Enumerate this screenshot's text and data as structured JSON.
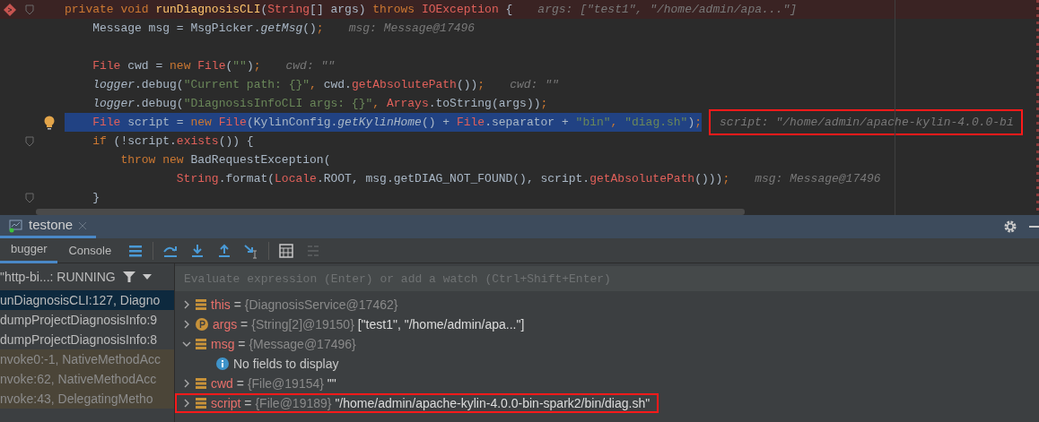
{
  "editor": {
    "lines": [
      {
        "kind": "code",
        "breakpoint": true,
        "current": false,
        "fold": true,
        "bulb": false,
        "tokens": [
          {
            "kind": "keyword",
            "text": "private void "
          },
          {
            "kind": "method",
            "text": "runDiagnosisCLI"
          },
          {
            "kind": "plain",
            "text": "("
          },
          {
            "kind": "type",
            "text": "String"
          },
          {
            "kind": "plain",
            "text": "[] args) "
          },
          {
            "kind": "keyword",
            "text": "throws "
          },
          {
            "kind": "type",
            "text": "IOException"
          },
          {
            "kind": "plain",
            "text": " {"
          }
        ],
        "hint": {
          "text": "args: [\"test1\", \"/home/admin/apa...\"]",
          "annotated": false
        }
      },
      {
        "kind": "code",
        "breakpoint": false,
        "current": false,
        "fold": false,
        "bulb": false,
        "tokens": [
          {
            "kind": "plain",
            "text": "    Message msg = MsgPicker."
          },
          {
            "kind": "static",
            "text": "getMsg"
          },
          {
            "kind": "plain",
            "text": "()"
          },
          {
            "kind": "keyword",
            "text": ";"
          }
        ],
        "hint": {
          "text": "msg: Message@17496",
          "annotated": false
        }
      },
      {
        "kind": "blank"
      },
      {
        "kind": "code",
        "breakpoint": false,
        "current": false,
        "fold": false,
        "bulb": false,
        "tokens": [
          {
            "kind": "type",
            "text": "    File"
          },
          {
            "kind": "plain",
            "text": " cwd = "
          },
          {
            "kind": "keyword",
            "text": "new "
          },
          {
            "kind": "type",
            "text": "File"
          },
          {
            "kind": "plain",
            "text": "("
          },
          {
            "kind": "string",
            "text": "\"\""
          },
          {
            "kind": "plain",
            "text": ")"
          },
          {
            "kind": "keyword",
            "text": ";"
          }
        ],
        "hint": {
          "text": "cwd: \"\"",
          "annotated": false
        }
      },
      {
        "kind": "code",
        "breakpoint": false,
        "current": false,
        "fold": false,
        "bulb": false,
        "tokens": [
          {
            "kind": "static",
            "text": "    logger"
          },
          {
            "kind": "plain",
            "text": ".debug("
          },
          {
            "kind": "string",
            "text": "\"Current path: {}\""
          },
          {
            "kind": "keyword",
            "text": ", "
          },
          {
            "kind": "plain",
            "text": "cwd."
          },
          {
            "kind": "type",
            "text": "getAbsolutePath"
          },
          {
            "kind": "plain",
            "text": "())"
          },
          {
            "kind": "keyword",
            "text": ";"
          }
        ],
        "hint": {
          "text": "cwd: \"\"",
          "annotated": false
        }
      },
      {
        "kind": "code",
        "breakpoint": false,
        "current": false,
        "fold": false,
        "bulb": false,
        "tokens": [
          {
            "kind": "static",
            "text": "    logger"
          },
          {
            "kind": "plain",
            "text": ".debug("
          },
          {
            "kind": "string",
            "text": "\"DiagnosisInfoCLI args: {}\""
          },
          {
            "kind": "keyword",
            "text": ", "
          },
          {
            "kind": "type",
            "text": "Arrays"
          },
          {
            "kind": "plain",
            "text": ".toString(args))"
          },
          {
            "kind": "keyword",
            "text": ";"
          }
        ]
      },
      {
        "kind": "code",
        "breakpoint": false,
        "current": true,
        "fold": false,
        "bulb": true,
        "tokens": [
          {
            "kind": "type",
            "text": "    File"
          },
          {
            "kind": "plain",
            "text": " script = "
          },
          {
            "kind": "keyword",
            "text": "new "
          },
          {
            "kind": "type",
            "text": "File"
          },
          {
            "kind": "plain",
            "text": "(KylinConfig."
          },
          {
            "kind": "static",
            "text": "getKylinHome"
          },
          {
            "kind": "plain",
            "text": "() + "
          },
          {
            "kind": "type",
            "text": "File"
          },
          {
            "kind": "plain",
            "text": ".separator + "
          },
          {
            "kind": "string",
            "text": "\"bin\""
          },
          {
            "kind": "keyword",
            "text": ", "
          },
          {
            "kind": "string",
            "text": "\"diag.sh\""
          },
          {
            "kind": "plain",
            "text": ")"
          },
          {
            "kind": "keyword",
            "text": ";"
          }
        ],
        "hint": {
          "text": "script: \"/home/admin/apache-kylin-4.0.0-bi",
          "annotated": true
        }
      },
      {
        "kind": "code",
        "breakpoint": false,
        "current": false,
        "fold": true,
        "bulb": false,
        "tokens": [
          {
            "kind": "keyword",
            "text": "    if "
          },
          {
            "kind": "plain",
            "text": "(!script."
          },
          {
            "kind": "type",
            "text": "exists"
          },
          {
            "kind": "plain",
            "text": "()) {"
          }
        ]
      },
      {
        "kind": "code",
        "breakpoint": false,
        "current": false,
        "fold": false,
        "bulb": false,
        "tokens": [
          {
            "kind": "keyword",
            "text": "        throw new "
          },
          {
            "kind": "plain",
            "text": "BadRequestException("
          }
        ]
      },
      {
        "kind": "code",
        "breakpoint": false,
        "current": false,
        "fold": false,
        "bulb": false,
        "tokens": [
          {
            "kind": "type",
            "text": "                String"
          },
          {
            "kind": "plain",
            "text": ".format("
          },
          {
            "kind": "type",
            "text": "Locale"
          },
          {
            "kind": "plain",
            "text": ".ROOT, msg.getDIAG_NOT_FOUND(), script."
          },
          {
            "kind": "type",
            "text": "getAbsolutePath"
          },
          {
            "kind": "plain",
            "text": "()))"
          },
          {
            "kind": "keyword",
            "text": ";"
          }
        ],
        "hint": {
          "text": "msg: Message@17496",
          "annotated": false
        }
      },
      {
        "kind": "code",
        "breakpoint": false,
        "current": false,
        "fold": true,
        "bulb": false,
        "tokens": [
          {
            "kind": "plain",
            "text": "    }"
          }
        ]
      }
    ]
  },
  "debug_window": {
    "title": "testone",
    "tabs": [
      {
        "label": "bugger",
        "selected": true
      },
      {
        "label": "Console",
        "selected": false
      }
    ],
    "thread": "\"http-bi...: RUNNING",
    "frames": [
      {
        "text": "unDiagnosisCLI:127, Diagno",
        "selected": true,
        "library": false
      },
      {
        "text": "dumpProjectDiagnosisInfo:9",
        "selected": false,
        "library": false
      },
      {
        "text": "dumpProjectDiagnosisInfo:8",
        "selected": false,
        "library": false
      },
      {
        "text": "nvoke0:-1, NativeMethodAcc",
        "selected": false,
        "library": true
      },
      {
        "text": "nvoke:62, NativeMethodAcc",
        "selected": false,
        "library": true
      },
      {
        "text": "nvoke:43, DelegatingMetho",
        "selected": false,
        "library": true
      }
    ],
    "evaluate": {
      "placeholder": "Evaluate expression (Enter) or add a watch (Ctrl+Shift+Enter)"
    },
    "variables": [
      {
        "kind": "field",
        "name": "this",
        "op": "=",
        "type": "{DiagnosisService@17462}",
        "expanded": false,
        "annotated": false
      },
      {
        "kind": "param",
        "name": "args",
        "op": "=",
        "type": "{String[2]@19150}",
        "value": "[\"test1\", \"/home/admin/apa...\"]",
        "expanded": false,
        "annotated": false
      },
      {
        "kind": "field",
        "name": "msg",
        "op": "=",
        "type": "{Message@17496}",
        "expanded": true,
        "annotated": false,
        "children": [
          {
            "kind": "info",
            "name": "No fields to display"
          }
        ]
      },
      {
        "kind": "field",
        "name": "cwd",
        "op": "=",
        "type": "{File@19154}",
        "value": "\"\"",
        "expanded": false,
        "annotated": false
      },
      {
        "kind": "field",
        "name": "script",
        "op": "=",
        "type": "{File@19189}",
        "value": "\"/home/admin/apache-kylin-4.0.0-bin-spark2/bin/diag.sh\"",
        "expanded": false,
        "annotated": true
      }
    ]
  }
}
